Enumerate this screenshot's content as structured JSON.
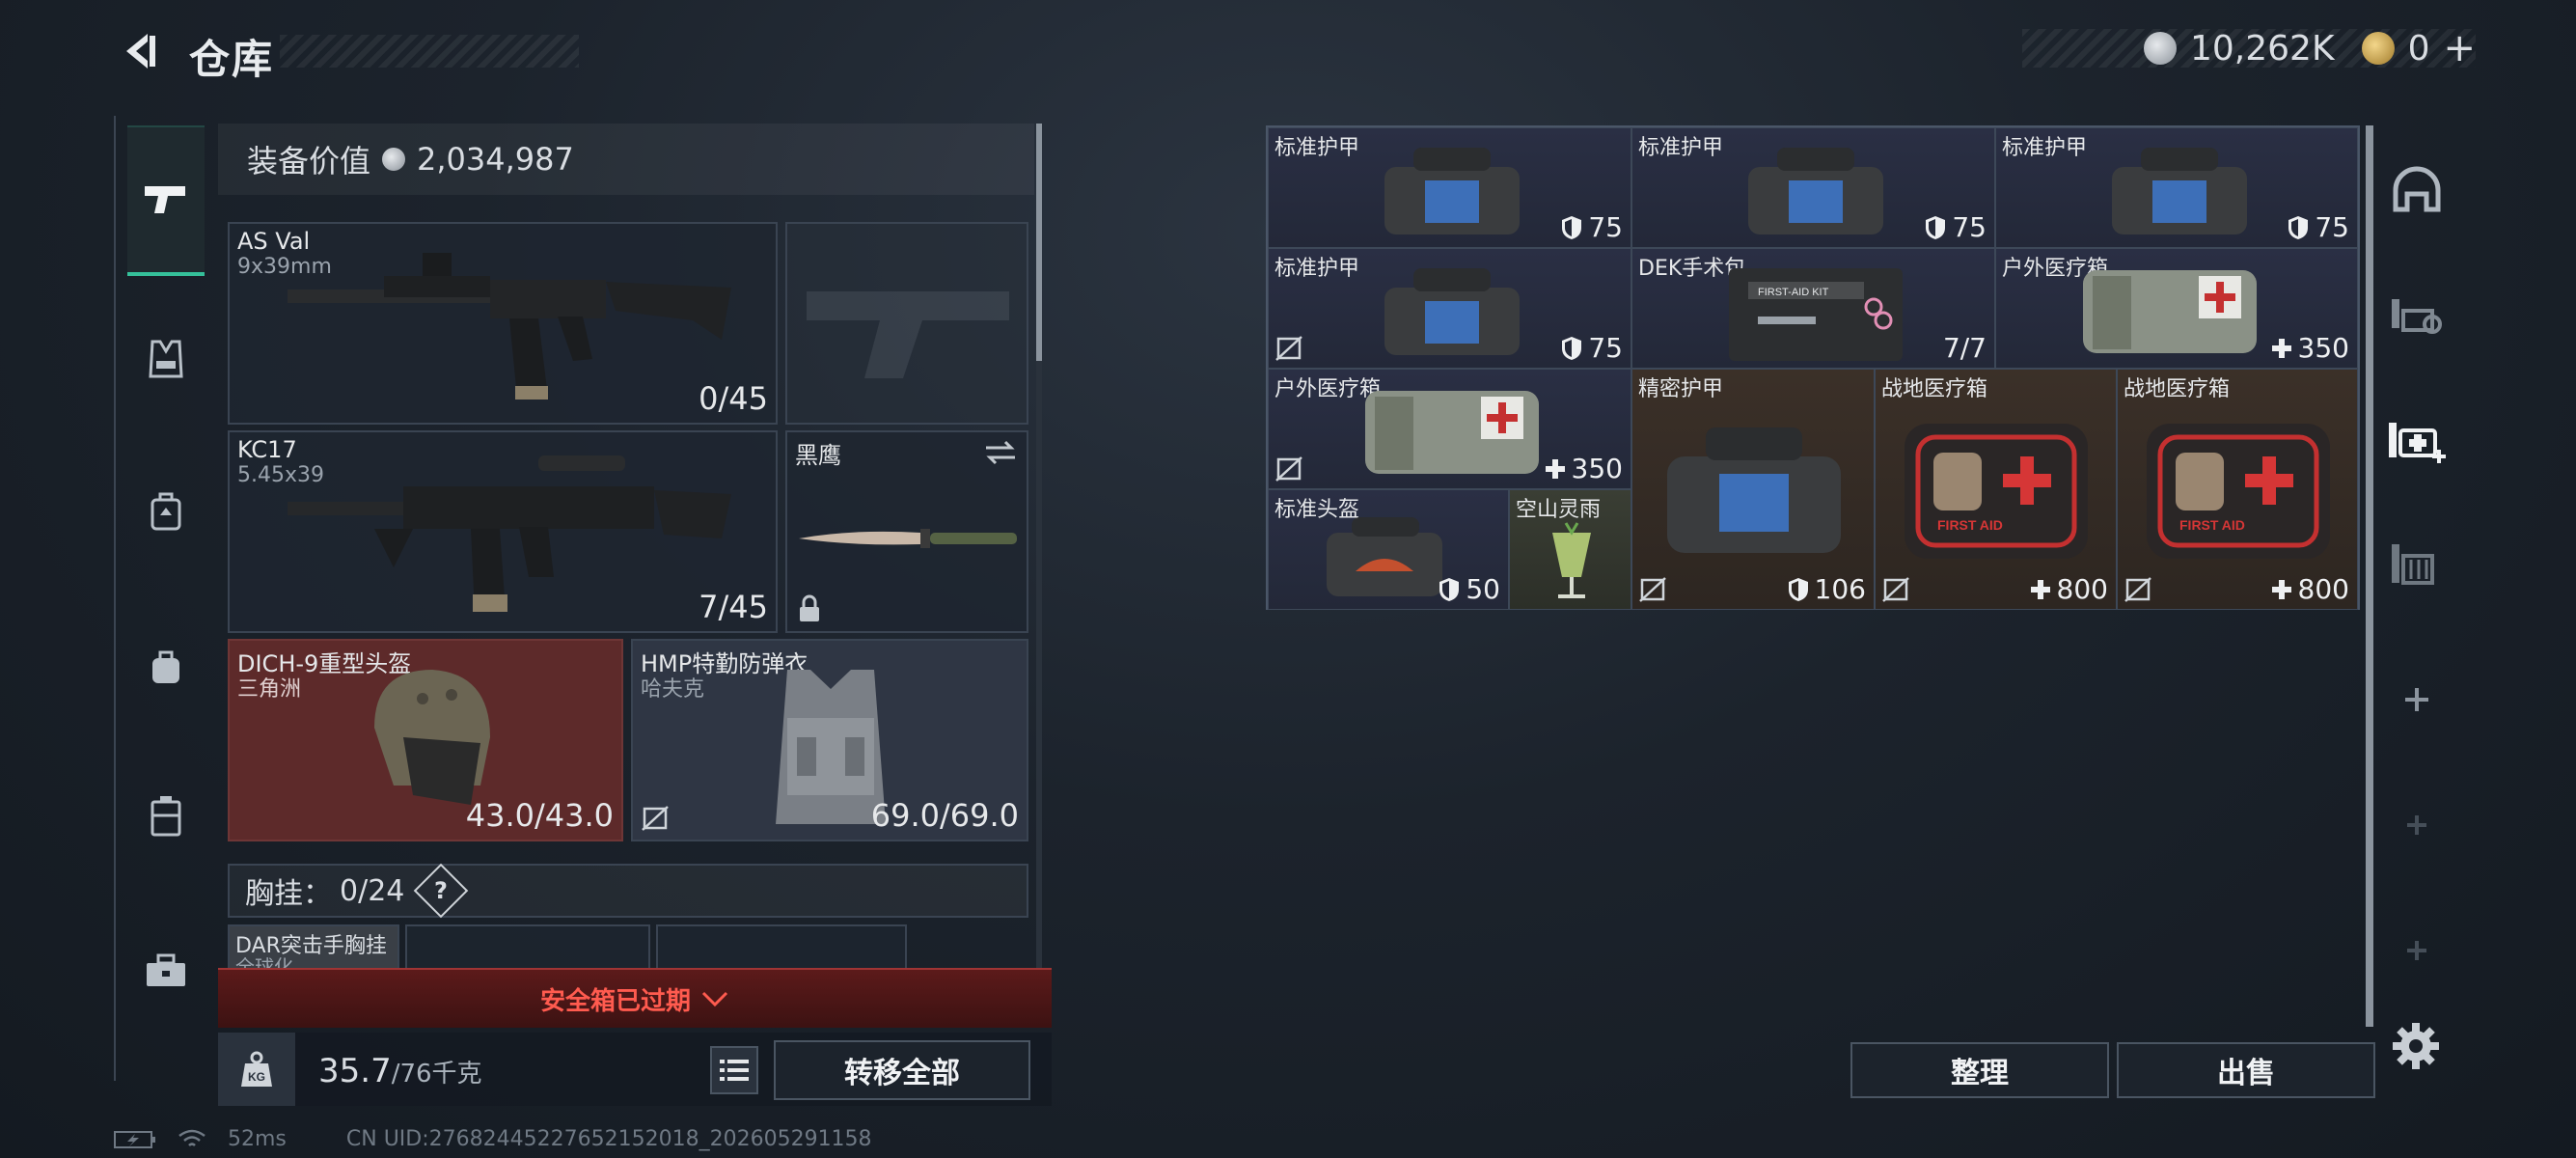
{
  "header": {
    "title": "仓库",
    "currency_silver": "10,262K",
    "currency_gold": "0",
    "gold_plus": "+"
  },
  "equip": {
    "value_label": "装备价值",
    "value": "2,034,987"
  },
  "weapons": [
    {
      "name": "AS Val",
      "caliber": "9x39mm",
      "ammo": "0/45"
    },
    {
      "name": "KC17",
      "caliber": "5.45x39",
      "ammo": "7/45"
    }
  ],
  "melee": {
    "name": "黑鹰"
  },
  "helmet": {
    "name": "DICH-9重型头盔",
    "sub": "三角洲",
    "durability": "43.0/43.0"
  },
  "armor": {
    "name": "HMP特勤防弹衣",
    "sub": "哈夫克",
    "durability": "69.0/69.0"
  },
  "chest": {
    "label": "胸挂：",
    "capacity": "0/24",
    "help": "?",
    "item_name": "DAR突击手胸挂",
    "item_sub": "全球化"
  },
  "safe_warning": "安全箱已过期",
  "weight": {
    "current": "35.7",
    "capacity": "/76千克",
    "icon": "KG"
  },
  "buttons": {
    "transfer_all": "转移全部",
    "organize": "整理",
    "sell": "出售"
  },
  "status": {
    "ping": "52ms",
    "uid": "CN UID:27682445227652152018_202605291158"
  },
  "grid_items": [
    {
      "name": "标准护甲",
      "value": "75",
      "kind": "armor"
    },
    {
      "name": "标准护甲",
      "value": "75",
      "kind": "armor"
    },
    {
      "name": "标准护甲",
      "value": "75",
      "kind": "armor"
    },
    {
      "name": "标准护甲",
      "value": "75",
      "kind": "armor"
    },
    {
      "name": "DEK手术包",
      "value": "7/7",
      "kind": "none"
    },
    {
      "name": "户外医疗箱",
      "value": "350",
      "kind": "heal"
    },
    {
      "name": "户外医疗箱",
      "value": "350",
      "kind": "heal"
    },
    {
      "name": "精密护甲",
      "value": "106",
      "kind": "armor"
    },
    {
      "name": "战地医疗箱",
      "value": "800",
      "kind": "heal"
    },
    {
      "name": "战地医疗箱",
      "value": "800",
      "kind": "heal"
    },
    {
      "name": "标准头盔",
      "value": "50",
      "kind": "armor"
    },
    {
      "name": "空山灵雨",
      "value": "",
      "kind": "none"
    }
  ],
  "first_aid_text": "FIRST AID",
  "first_aid_kit_text": "FIRST-AID KIT",
  "colors": {
    "accent_green": "#35c09a",
    "warning_red": "#ff5b4f",
    "grid_border": "#4a5668"
  },
  "icons": [
    "back-arrow-icon",
    "silver-coin-icon",
    "gold-coin-icon",
    "pistol-icon",
    "vest-icon",
    "backpack-icon",
    "bag-icon",
    "case-icon",
    "toolbox-icon",
    "lock-icon",
    "swap-icon",
    "kg-weight-icon",
    "list-icon",
    "settings-icon",
    "plus-icon",
    "helmet-tab-icon",
    "gear-tab-icon",
    "medkit-tab-icon",
    "shelf-tab-icon"
  ]
}
